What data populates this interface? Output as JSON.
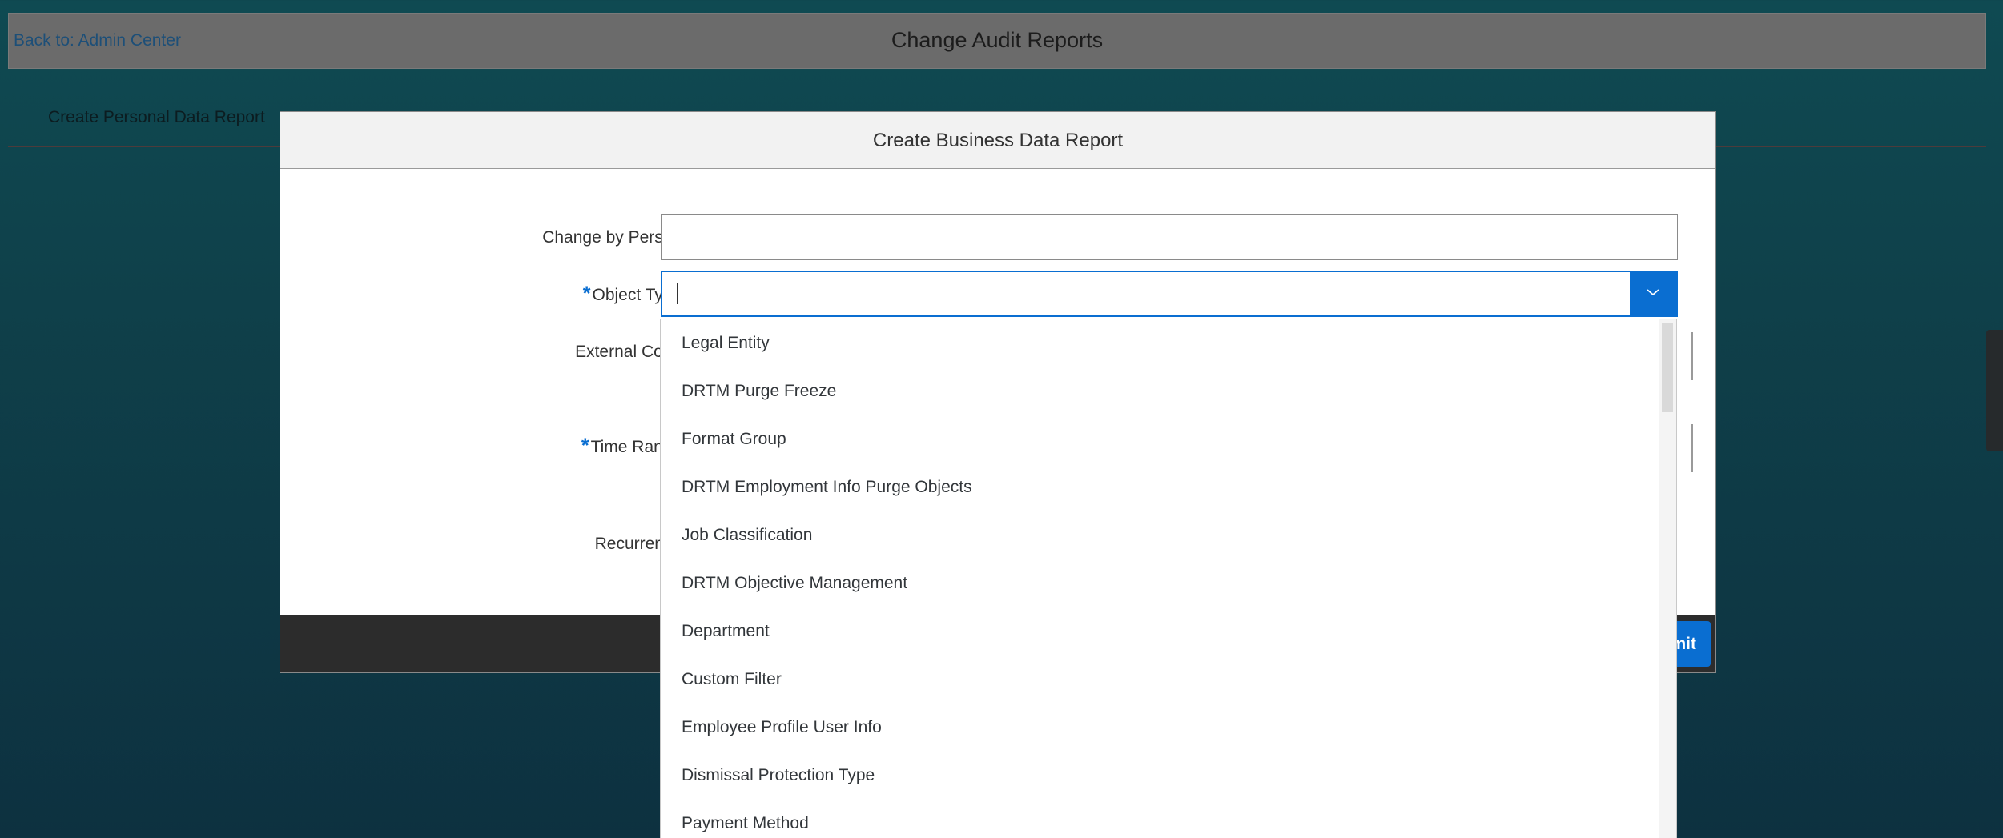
{
  "page": {
    "back_link": "Back to: Admin Center",
    "title": "Change Audit Reports",
    "tab_personal": "Create Personal Data Report"
  },
  "dialog": {
    "title": "Create Business Data Report",
    "fields": {
      "change_by_person": {
        "label": "Change by Person:",
        "value": ""
      },
      "object_type": {
        "label": "Object Type:",
        "required_marker": "*",
        "value": ""
      },
      "external_code": {
        "label": "External Code:"
      },
      "time_range": {
        "label": "Time Range:",
        "required_marker": "*"
      },
      "recurrence": {
        "label": "Recurrence:"
      }
    },
    "footer": {
      "submit_label_visible": "mit"
    }
  },
  "dropdown": {
    "options": [
      "Legal Entity",
      "DRTM Purge Freeze",
      "Format Group",
      "DRTM Employment Info Purge Objects",
      "Job Classification",
      "DRTM Objective Management",
      "Department",
      "Custom Filter",
      "Employee Profile User Info",
      "Dismissal Protection Type",
      "Payment Method"
    ]
  },
  "colors": {
    "accent": "#0a6ed1",
    "backdrop": "#0f4a52",
    "topbar": "#6b6b6b",
    "footer": "#2c2c2c"
  },
  "icons": {
    "combo_toggle": "chevron-down-icon"
  }
}
